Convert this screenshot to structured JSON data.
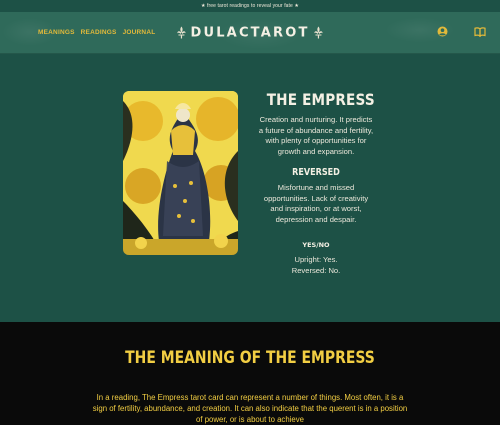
{
  "promo": "★ free tarot readings to reveal your fate ★",
  "nav": {
    "links": [
      "MEANINGS",
      "READINGS",
      "JOURNAL"
    ],
    "brand": "DULACTAROT",
    "icons": [
      "account-icon",
      "book-icon"
    ]
  },
  "card": {
    "title": "THE EMPRESS",
    "upright_text": "Creation and nurturing. It predicts a future of abundance and fertility, with plenty of opportunities for growth and expansion.",
    "reversed_heading": "REVERSED",
    "reversed_text": "Misfortune and missed opportunities. Lack of creativity and inspiration, or at worst, depression and despair.",
    "yesno_heading": "YES/NO",
    "upright_answer": "Upright: Yes.",
    "reversed_answer": "Reversed: No."
  },
  "meaning": {
    "title": "THE MEANING OF THE EMPRESS",
    "text": "In a reading, The Empress tarot card can represent a number of things. Most often, it is a sign of fertility, abundance, and creation. It can also indicate that the querent is in a position of power, or is about to achieve"
  },
  "colors": {
    "background": "#1d5146",
    "nav": "#2f6a5a",
    "gold": "#e2b93a",
    "meaning_bg": "#0a0a0a",
    "meaning_text": "#f2ce43"
  }
}
